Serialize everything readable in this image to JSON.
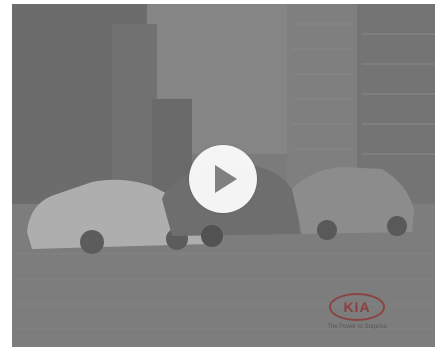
{
  "player": {
    "play_label": "Play video",
    "brand_logo": "KIA",
    "brand_tagline": "The Power to Surprise"
  },
  "colors": {
    "overlay": "#7a7a7a",
    "play_button_bg": "#ffffff",
    "play_icon": "#808080",
    "brand": "#961414"
  },
  "icons": {
    "play": "play-icon"
  }
}
